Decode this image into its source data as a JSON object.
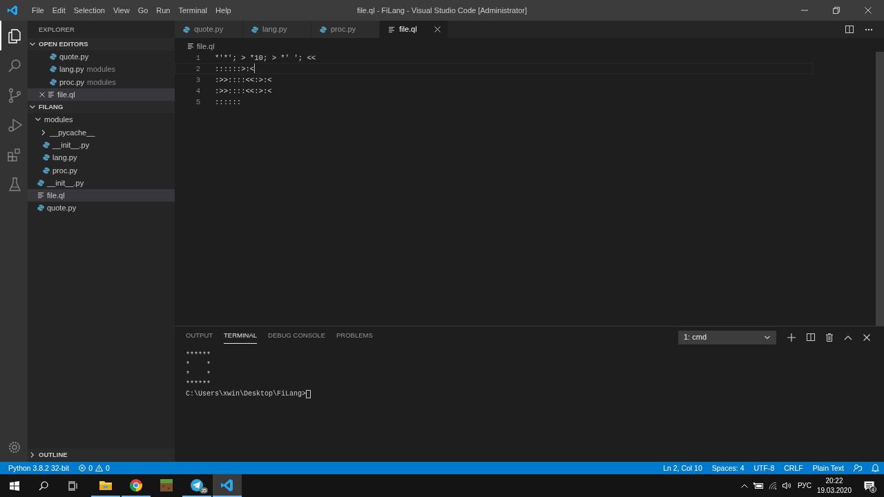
{
  "window": {
    "title": "file.ql - FiLang - Visual Studio Code [Administrator]"
  },
  "menu": [
    "File",
    "Edit",
    "Selection",
    "View",
    "Go",
    "Run",
    "Terminal",
    "Help"
  ],
  "activity_bar": [
    {
      "kind": "files",
      "selected": true
    },
    {
      "kind": "search",
      "selected": false
    },
    {
      "kind": "source-control",
      "selected": false
    },
    {
      "kind": "run",
      "selected": false
    },
    {
      "kind": "extensions",
      "selected": false
    },
    {
      "kind": "test",
      "selected": false
    }
  ],
  "sidebar": {
    "title": "EXPLORER",
    "open_editors": {
      "label": "OPEN EDITORS",
      "expanded": true,
      "items": [
        {
          "name": "quote.py",
          "kind": "python",
          "selected": false
        },
        {
          "name": "lang.py",
          "detail": "modules",
          "kind": "python",
          "selected": false
        },
        {
          "name": "proc.py",
          "detail": "modules",
          "kind": "python",
          "selected": false
        },
        {
          "name": "file.ql",
          "kind": "text",
          "selected": true
        }
      ]
    },
    "folder": {
      "label": "FILANG",
      "expanded": true,
      "children": [
        {
          "name": "modules",
          "kind": "folder",
          "expanded": true,
          "selected": false,
          "children": [
            {
              "name": "__pycache__",
              "kind": "folder",
              "expanded": false,
              "selected": false
            },
            {
              "name": "__init__.py",
              "kind": "python",
              "selected": false
            },
            {
              "name": "lang.py",
              "kind": "python",
              "selected": false
            },
            {
              "name": "proc.py",
              "kind": "python",
              "selected": false
            }
          ]
        },
        {
          "name": "__init__.py",
          "kind": "python",
          "selected": false
        },
        {
          "name": "file.ql",
          "kind": "text",
          "selected": true
        },
        {
          "name": "quote.py",
          "kind": "python",
          "selected": false
        }
      ]
    },
    "outline": {
      "label": "OUTLINE",
      "expanded": false
    }
  },
  "tabs": [
    {
      "label": "quote.py",
      "kind": "python",
      "selected": false
    },
    {
      "label": "lang.py",
      "kind": "python",
      "selected": false
    },
    {
      "label": "proc.py",
      "kind": "python",
      "selected": false
    },
    {
      "label": "file.ql",
      "kind": "text",
      "selected": true
    }
  ],
  "breadcrumb": "file.ql",
  "code": [
    {
      "number": "1",
      "text": "*'*'; > *10; > *' '; <<",
      "current": false
    },
    {
      "number": "2",
      "text": "::::::>:<",
      "current": true
    },
    {
      "number": "3",
      "text": ":>>::::<<:>:<",
      "current": false
    },
    {
      "number": "4",
      "text": ":>>::::<<:>:<",
      "current": false
    },
    {
      "number": "5",
      "text": "::::::",
      "current": false
    }
  ],
  "panel": {
    "tabs": [
      {
        "label": "OUTPUT",
        "selected": false
      },
      {
        "label": "TERMINAL",
        "selected": true
      },
      {
        "label": "DEBUG CONSOLE",
        "selected": false
      },
      {
        "label": "PROBLEMS",
        "selected": false
      }
    ],
    "terminal_select": "1: cmd",
    "terminal_lines": [
      "******",
      "*    *",
      "*    *",
      "******",
      "C:\\Users\\xwin\\Desktop\\FiLang>"
    ]
  },
  "status_bar": {
    "left": [
      {
        "kind": "text",
        "text": "Python 3.8.2 32-bit"
      },
      {
        "kind": "problems",
        "errors": "0",
        "warnings": "0"
      }
    ],
    "right": [
      "Ln 2, Col 10",
      "Spaces: 4",
      "UTF-8",
      "CRLF",
      "Plain Text"
    ]
  },
  "taskbar": {
    "apps": [
      {
        "kind": "folder",
        "running": true,
        "selected": false
      },
      {
        "kind": "browser",
        "running": true,
        "selected": false
      },
      {
        "kind": "game",
        "running": false,
        "selected": false
      },
      {
        "kind": "messenger",
        "running": true,
        "selected": false,
        "badge": "35"
      },
      {
        "kind": "editor",
        "running": true,
        "selected": true
      }
    ],
    "language": "РУС",
    "time": "20:22",
    "date": "19.03.2020",
    "notifications": "4"
  }
}
